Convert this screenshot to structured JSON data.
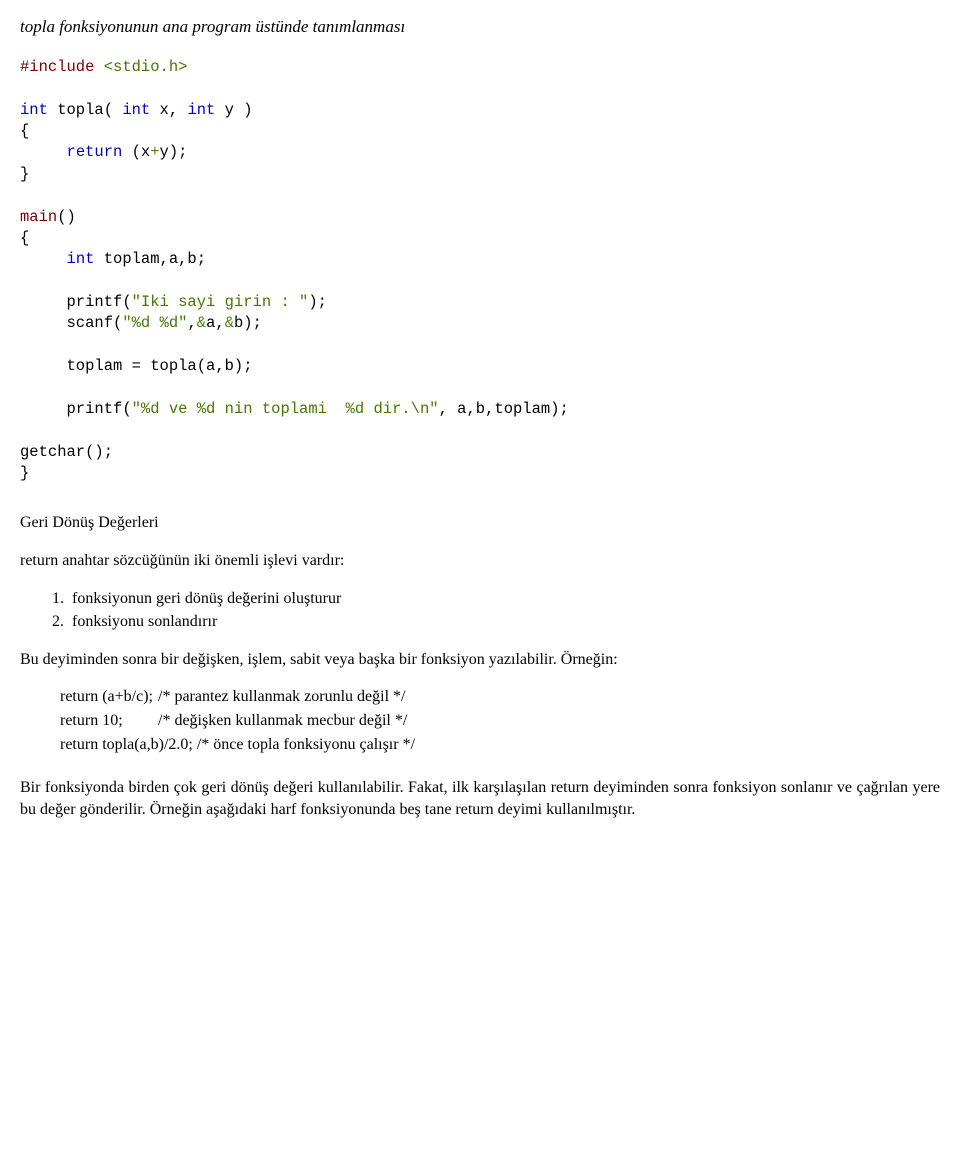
{
  "title_italic": "topla fonksiyonunun ana program üstünde tanımlanması",
  "code": {
    "l1a": "#include ",
    "l1b": "<stdio.h>",
    "l2a": "int",
    "l2b": " topla( ",
    "l2c": "int",
    "l2d": " x, ",
    "l2e": "int",
    "l2f": " y )",
    "l3": "{",
    "l4a": "     ",
    "l4b": "return",
    "l4c": " (x",
    "l4d": "+",
    "l4e": "y);",
    "l5": "}",
    "l6a": "main",
    "l6b": "()",
    "l7": "{",
    "l8a": "     ",
    "l8b": "int",
    "l8c": " toplam,a,b;",
    "l9a": "     printf(",
    "l9b": "\"Iki sayi girin : \"",
    "l9c": ");",
    "l10a": "     scanf(",
    "l10b": "\"%d %d\"",
    "l10c": ",",
    "l10d": "&",
    "l10e": "a,",
    "l10f": "&",
    "l10g": "b);",
    "l11": "     toplam = topla(a,b);",
    "l12a": "     printf(",
    "l12b": "\"%d ve %d nin toplami  %d dir.\\n\"",
    "l12c": ", a,b,toplam);",
    "l13": "getchar();",
    "l14": "}"
  },
  "heading": "Geri Dönüş Değerleri",
  "p1": "return anahtar sözcüğünün iki önemli işlevi vardır:",
  "list": {
    "i1": "fonksiyonun geri dönüş değerini oluşturur",
    "i2": "fonksiyonu sonlandırır"
  },
  "p2": "Bu deyiminden sonra bir değişken, işlem, sabit veya başka bir fonksiyon yazılabilir. Örneğin:",
  "ret": {
    "r1a": "return (a+b/c);",
    "r1b": "/* parantez kullanmak zorunlu değil */",
    "r2a": "return 10;",
    "r2b": "/* değişken kullanmak mecbur değil */",
    "r3a": "return topla(a,b)/2.0;  /* önce topla fonksiyonu çalışır */"
  },
  "p3": "Bir fonksiyonda birden çok geri dönüş değeri kullanılabilir. Fakat, ilk karşılaşılan return deyiminden sonra fonksiyon sonlanır ve çağrılan yere bu değer gönderilir. Örneğin aşağıdaki harf fonksiyonunda beş tane return deyimi kullanılmıştır."
}
